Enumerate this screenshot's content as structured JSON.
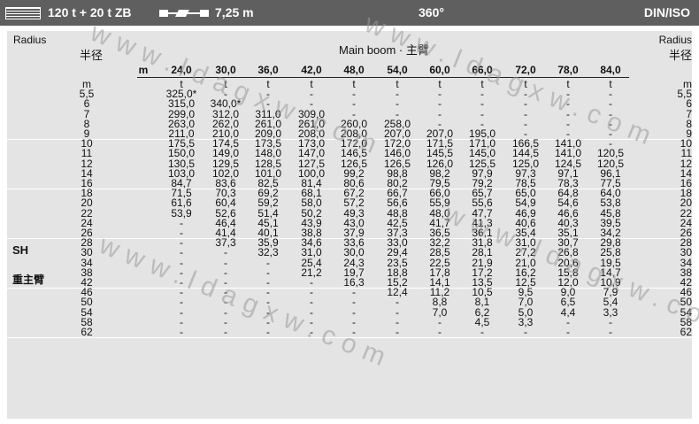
{
  "topbar": {
    "config": "120 t + 20 t ZB",
    "jib_length": "7,25 m",
    "slew": "360°",
    "norm": "DIN/ISO"
  },
  "headers": {
    "radius_en_left": "Radius",
    "radius_cn_left": "半径",
    "radius_en_right": "Radius",
    "radius_cn_right": "半径",
    "boom_title": "Main boom · 主臂",
    "m_unit": "m",
    "side_sh": "SH",
    "side_cn": "重主臂"
  },
  "boom_lengths": [
    "24,0",
    "30,0",
    "36,0",
    "42,0",
    "48,0",
    "54,0",
    "60,0",
    "66,0",
    "72,0",
    "78,0",
    "84,0"
  ],
  "rows": [
    {
      "r": "m",
      "v": [
        "t",
        "t",
        "t",
        "t",
        "t",
        "t",
        "t",
        "t",
        "t",
        "t",
        "t"
      ]
    },
    {
      "r": "5,5",
      "v": [
        "325,0*",
        "-",
        "-",
        "-",
        "-",
        "-",
        "-",
        "-",
        "-",
        "-",
        "-"
      ]
    },
    {
      "r": "6",
      "v": [
        "315,0",
        "340,0*",
        "-",
        "-",
        "-",
        "-",
        "-",
        "-",
        "-",
        "-",
        "-"
      ]
    },
    {
      "r": "7",
      "v": [
        "299,0",
        "312,0",
        "311,0",
        "309,0",
        "-",
        "-",
        "-",
        "-",
        "-",
        "-",
        "-"
      ]
    },
    {
      "r": "8",
      "v": [
        "263,0",
        "262,0",
        "261,0",
        "261,0",
        "260,0",
        "258,0",
        "-",
        "-",
        "-",
        "-",
        "-"
      ]
    },
    {
      "r": "9",
      "v": [
        "211,0",
        "210,0",
        "209,0",
        "208,0",
        "208,0",
        "207,0",
        "207,0",
        "195,0",
        "-",
        "-",
        "-"
      ]
    },
    {
      "r": "10",
      "v": [
        "175,5",
        "174,5",
        "173,5",
        "173,0",
        "172,0",
        "172,0",
        "171,5",
        "171,0",
        "166,5",
        "141,0",
        "-"
      ]
    },
    {
      "r": "11",
      "v": [
        "150,0",
        "149,0",
        "148,0",
        "147,0",
        "146,5",
        "146,0",
        "145,5",
        "145,0",
        "144,5",
        "141,0",
        "120,5"
      ]
    },
    {
      "r": "12",
      "v": [
        "130,5",
        "129,5",
        "128,5",
        "127,5",
        "126,5",
        "126,5",
        "126,0",
        "125,5",
        "125,0",
        "124,5",
        "120,5"
      ]
    },
    {
      "r": "14",
      "v": [
        "103,0",
        "102,0",
        "101,0",
        "100,0",
        "99,2",
        "98,8",
        "98,2",
        "97,9",
        "97,3",
        "97,1",
        "96,1"
      ]
    },
    {
      "r": "16",
      "v": [
        "84,7",
        "83,6",
        "82,5",
        "81,4",
        "80,6",
        "80,2",
        "79,5",
        "79,2",
        "78,5",
        "78,3",
        "77,5"
      ]
    },
    {
      "r": "18",
      "v": [
        "71,5",
        "70,3",
        "69,2",
        "68,1",
        "67,2",
        "66,7",
        "66,0",
        "65,7",
        "65,0",
        "64,8",
        "64,0"
      ]
    },
    {
      "r": "20",
      "v": [
        "61,6",
        "60,4",
        "59,2",
        "58,0",
        "57,2",
        "56,6",
        "55,9",
        "55,6",
        "54,9",
        "54,6",
        "53,8"
      ]
    },
    {
      "r": "22",
      "v": [
        "53,9",
        "52,6",
        "51,4",
        "50,2",
        "49,3",
        "48,8",
        "48,0",
        "47,7",
        "46,9",
        "46,6",
        "45,8"
      ]
    },
    {
      "r": "24",
      "v": [
        "-",
        "46,4",
        "45,1",
        "43,9",
        "43,0",
        "42,5",
        "41,7",
        "41,3",
        "40,6",
        "40,3",
        "39,5"
      ]
    },
    {
      "r": "26",
      "v": [
        "-",
        "41,4",
        "40,1",
        "38,8",
        "37,9",
        "37,3",
        "36,5",
        "36,1",
        "35,4",
        "35,1",
        "34,2"
      ]
    },
    {
      "r": "28",
      "v": [
        "-",
        "37,3",
        "35,9",
        "34,6",
        "33,6",
        "33,0",
        "32,2",
        "31,8",
        "31,0",
        "30,7",
        "29,8"
      ]
    },
    {
      "r": "30",
      "v": [
        "-",
        "-",
        "32,3",
        "31,0",
        "30,0",
        "29,4",
        "28,5",
        "28,1",
        "27,2",
        "26,8",
        "25,8"
      ]
    },
    {
      "r": "34",
      "v": [
        "-",
        "-",
        "-",
        "25,4",
        "24,3",
        "23,5",
        "22,5",
        "21,9",
        "21,0",
        "20,6",
        "19,5"
      ]
    },
    {
      "r": "38",
      "v": [
        "-",
        "-",
        "-",
        "21,2",
        "19,7",
        "18,8",
        "17,8",
        "17,2",
        "16,2",
        "15,8",
        "14,7"
      ]
    },
    {
      "r": "42",
      "v": [
        "-",
        "-",
        "-",
        "-",
        "16,3",
        "15,2",
        "14,1",
        "13,5",
        "12,5",
        "12,0",
        "10,9"
      ]
    },
    {
      "r": "46",
      "v": [
        "-",
        "-",
        "-",
        "-",
        "-",
        "12,4",
        "11,2",
        "10,5",
        "9,5",
        "9,0",
        "7,9"
      ]
    },
    {
      "r": "50",
      "v": [
        "-",
        "-",
        "-",
        "-",
        "-",
        "-",
        "8,8",
        "8,1",
        "7,0",
        "6,5",
        "5,4"
      ]
    },
    {
      "r": "54",
      "v": [
        "-",
        "-",
        "-",
        "-",
        "-",
        "-",
        "7,0",
        "6,2",
        "5,0",
        "4,4",
        "3,3"
      ]
    },
    {
      "r": "58",
      "v": [
        "-",
        "-",
        "-",
        "-",
        "-",
        "-",
        "-",
        "4,5",
        "3,3",
        "-",
        "-"
      ]
    },
    {
      "r": "62",
      "v": [
        "-",
        "-",
        "-",
        "-",
        "-",
        "-",
        "-",
        "-",
        "-",
        "-",
        "-"
      ]
    }
  ],
  "watermark": "www.ldagxw.com"
}
